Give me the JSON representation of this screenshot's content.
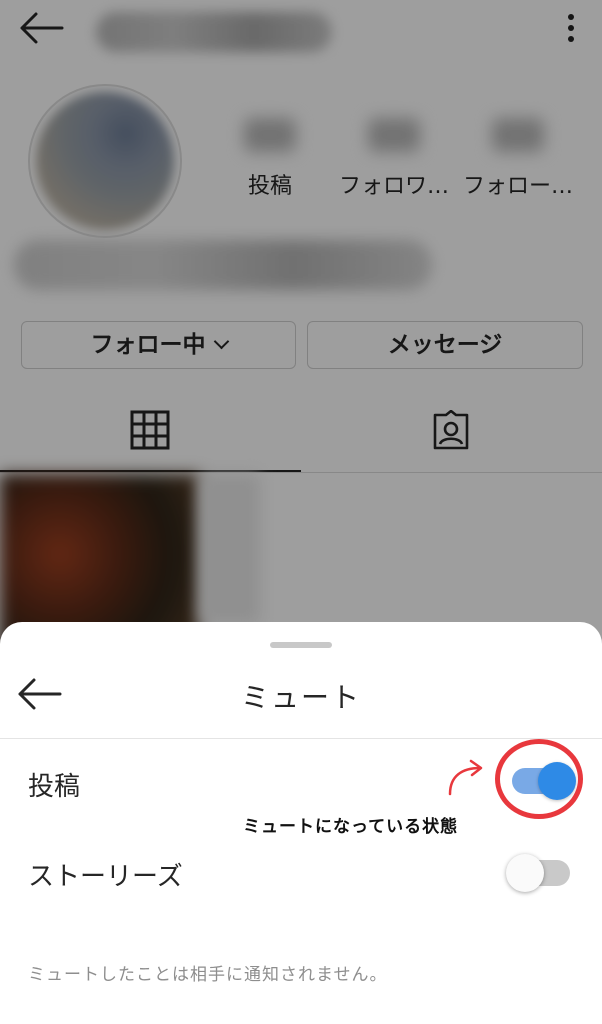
{
  "profile": {
    "stats": [
      {
        "label": "投稿"
      },
      {
        "label": "フォロワ…"
      },
      {
        "label": "フォロー…"
      }
    ],
    "buttons": {
      "following": "フォロー中",
      "message": "メッセージ"
    },
    "tabs": [
      {
        "icon": "grid-icon"
      },
      {
        "icon": "tagged-icon"
      }
    ]
  },
  "mute_sheet": {
    "title": "ミュート",
    "options": [
      {
        "label": "投稿",
        "enabled": true
      },
      {
        "label": "ストーリーズ",
        "enabled": false
      }
    ],
    "footnote": "ミュートしたことは相手に通知されません。"
  },
  "annotation": {
    "text": "ミュートになっている状態",
    "color": "#e8383d"
  },
  "colors": {
    "toggle_on_track": "#79a9e6",
    "toggle_on_knob": "#2e8ae6",
    "toggle_off_track": "#c9c9c9"
  }
}
